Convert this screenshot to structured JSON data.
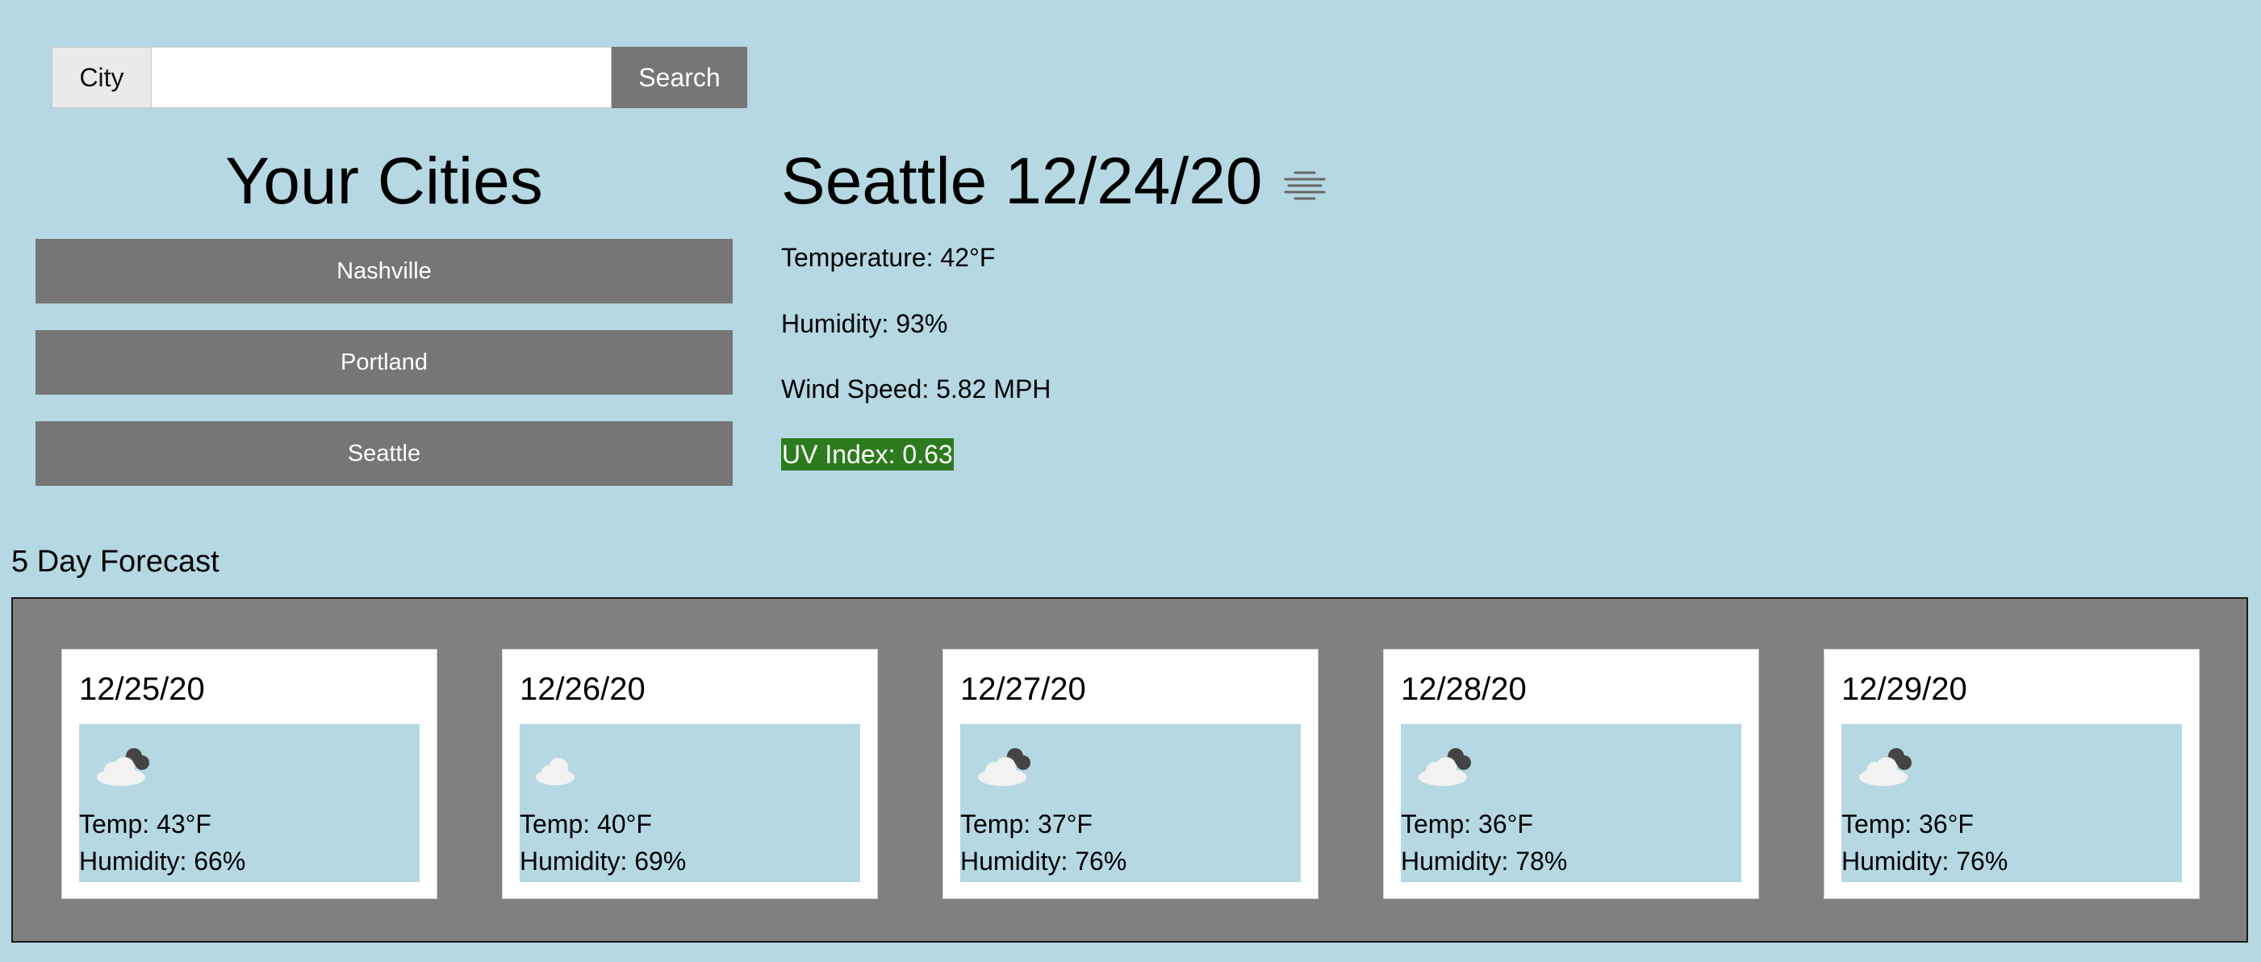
{
  "search": {
    "label": "City",
    "value": "",
    "placeholder": "",
    "button_label": "Search"
  },
  "sidebar": {
    "title": "Your Cities",
    "cities": [
      {
        "label": "Nashville"
      },
      {
        "label": "Portland"
      },
      {
        "label": "Seattle"
      }
    ]
  },
  "current": {
    "city": "Seattle",
    "date": "12/24/20",
    "icon": "fog-icon",
    "temperature": "Temperature: 42°F",
    "humidity": "Humidity: 93%",
    "wind_speed": "Wind Speed: 5.82 MPH",
    "uv_index": "UV Index: 0.63",
    "uv_color": "#2e7b1f"
  },
  "forecast": {
    "heading": "5 Day Forecast",
    "days": [
      {
        "date": "12/25/20",
        "icon": "partly-cloudy-icon",
        "temp": "Temp: 43°F",
        "humidity": "Humidity: 66%"
      },
      {
        "date": "12/26/20",
        "icon": "cloud-icon",
        "temp": "Temp: 40°F",
        "humidity": "Humidity: 69%"
      },
      {
        "date": "12/27/20",
        "icon": "partly-cloudy-icon",
        "temp": "Temp: 37°F",
        "humidity": "Humidity: 76%"
      },
      {
        "date": "12/28/20",
        "icon": "partly-cloudy-icon",
        "temp": "Temp: 36°F",
        "humidity": "Humidity: 78%"
      },
      {
        "date": "12/29/20",
        "icon": "partly-cloudy-icon",
        "temp": "Temp: 36°F",
        "humidity": "Humidity: 76%"
      }
    ]
  },
  "colors": {
    "background": "#b5d8e3",
    "button": "#767676",
    "panel": "#808080"
  }
}
